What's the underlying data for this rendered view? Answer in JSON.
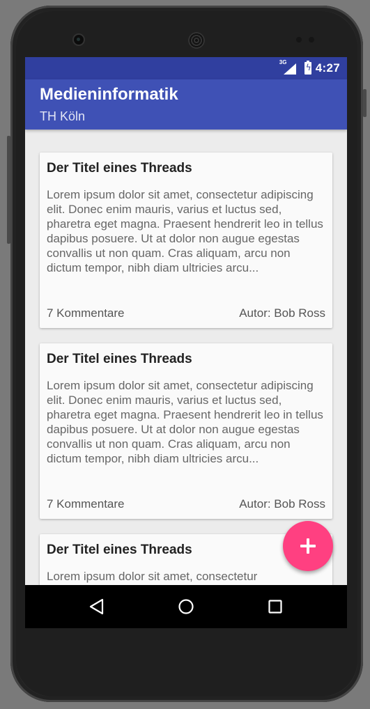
{
  "status_bar": {
    "network_label": "3G",
    "time": "4:27",
    "icons": [
      "signal-icon",
      "battery-charging-icon"
    ]
  },
  "app_bar": {
    "title": "Medieninformatik",
    "subtitle": "TH Köln",
    "color": "#3f51b5"
  },
  "threads": [
    {
      "title": "Der Titel eines Threads",
      "body": "Lorem ipsum dolor sit amet, consectetur adipiscing elit. Donec enim mauris, varius et luctus sed, pharetra eget magna. Praesent hendrerit leo in tellus dapibus posuere. Ut at dolor non augue egestas convallis ut non quam. Cras aliquam, arcu non dictum tempor, nibh diam ultricies arcu...",
      "comments": "7 Kommentare",
      "author": "Autor: Bob Ross"
    },
    {
      "title": "Der Titel eines Threads",
      "body": "Lorem ipsum dolor sit amet, consectetur adipiscing elit. Donec enim mauris, varius et luctus sed, pharetra eget magna. Praesent hendrerit leo in tellus dapibus posuere. Ut at dolor non augue egestas convallis ut non quam. Cras aliquam, arcu non dictum tempor, nibh diam ultricies arcu...",
      "comments": "7 Kommentare",
      "author": "Autor: Bob Ross"
    },
    {
      "title": "Der Titel eines Threads",
      "body": "Lorem ipsum dolor sit amet, consectetur",
      "comments": "",
      "author": ""
    }
  ],
  "fab": {
    "icon": "plus-icon",
    "color": "#ff4081"
  },
  "nav_bar": {
    "icons": [
      "back-icon",
      "home-icon",
      "recents-icon"
    ]
  }
}
